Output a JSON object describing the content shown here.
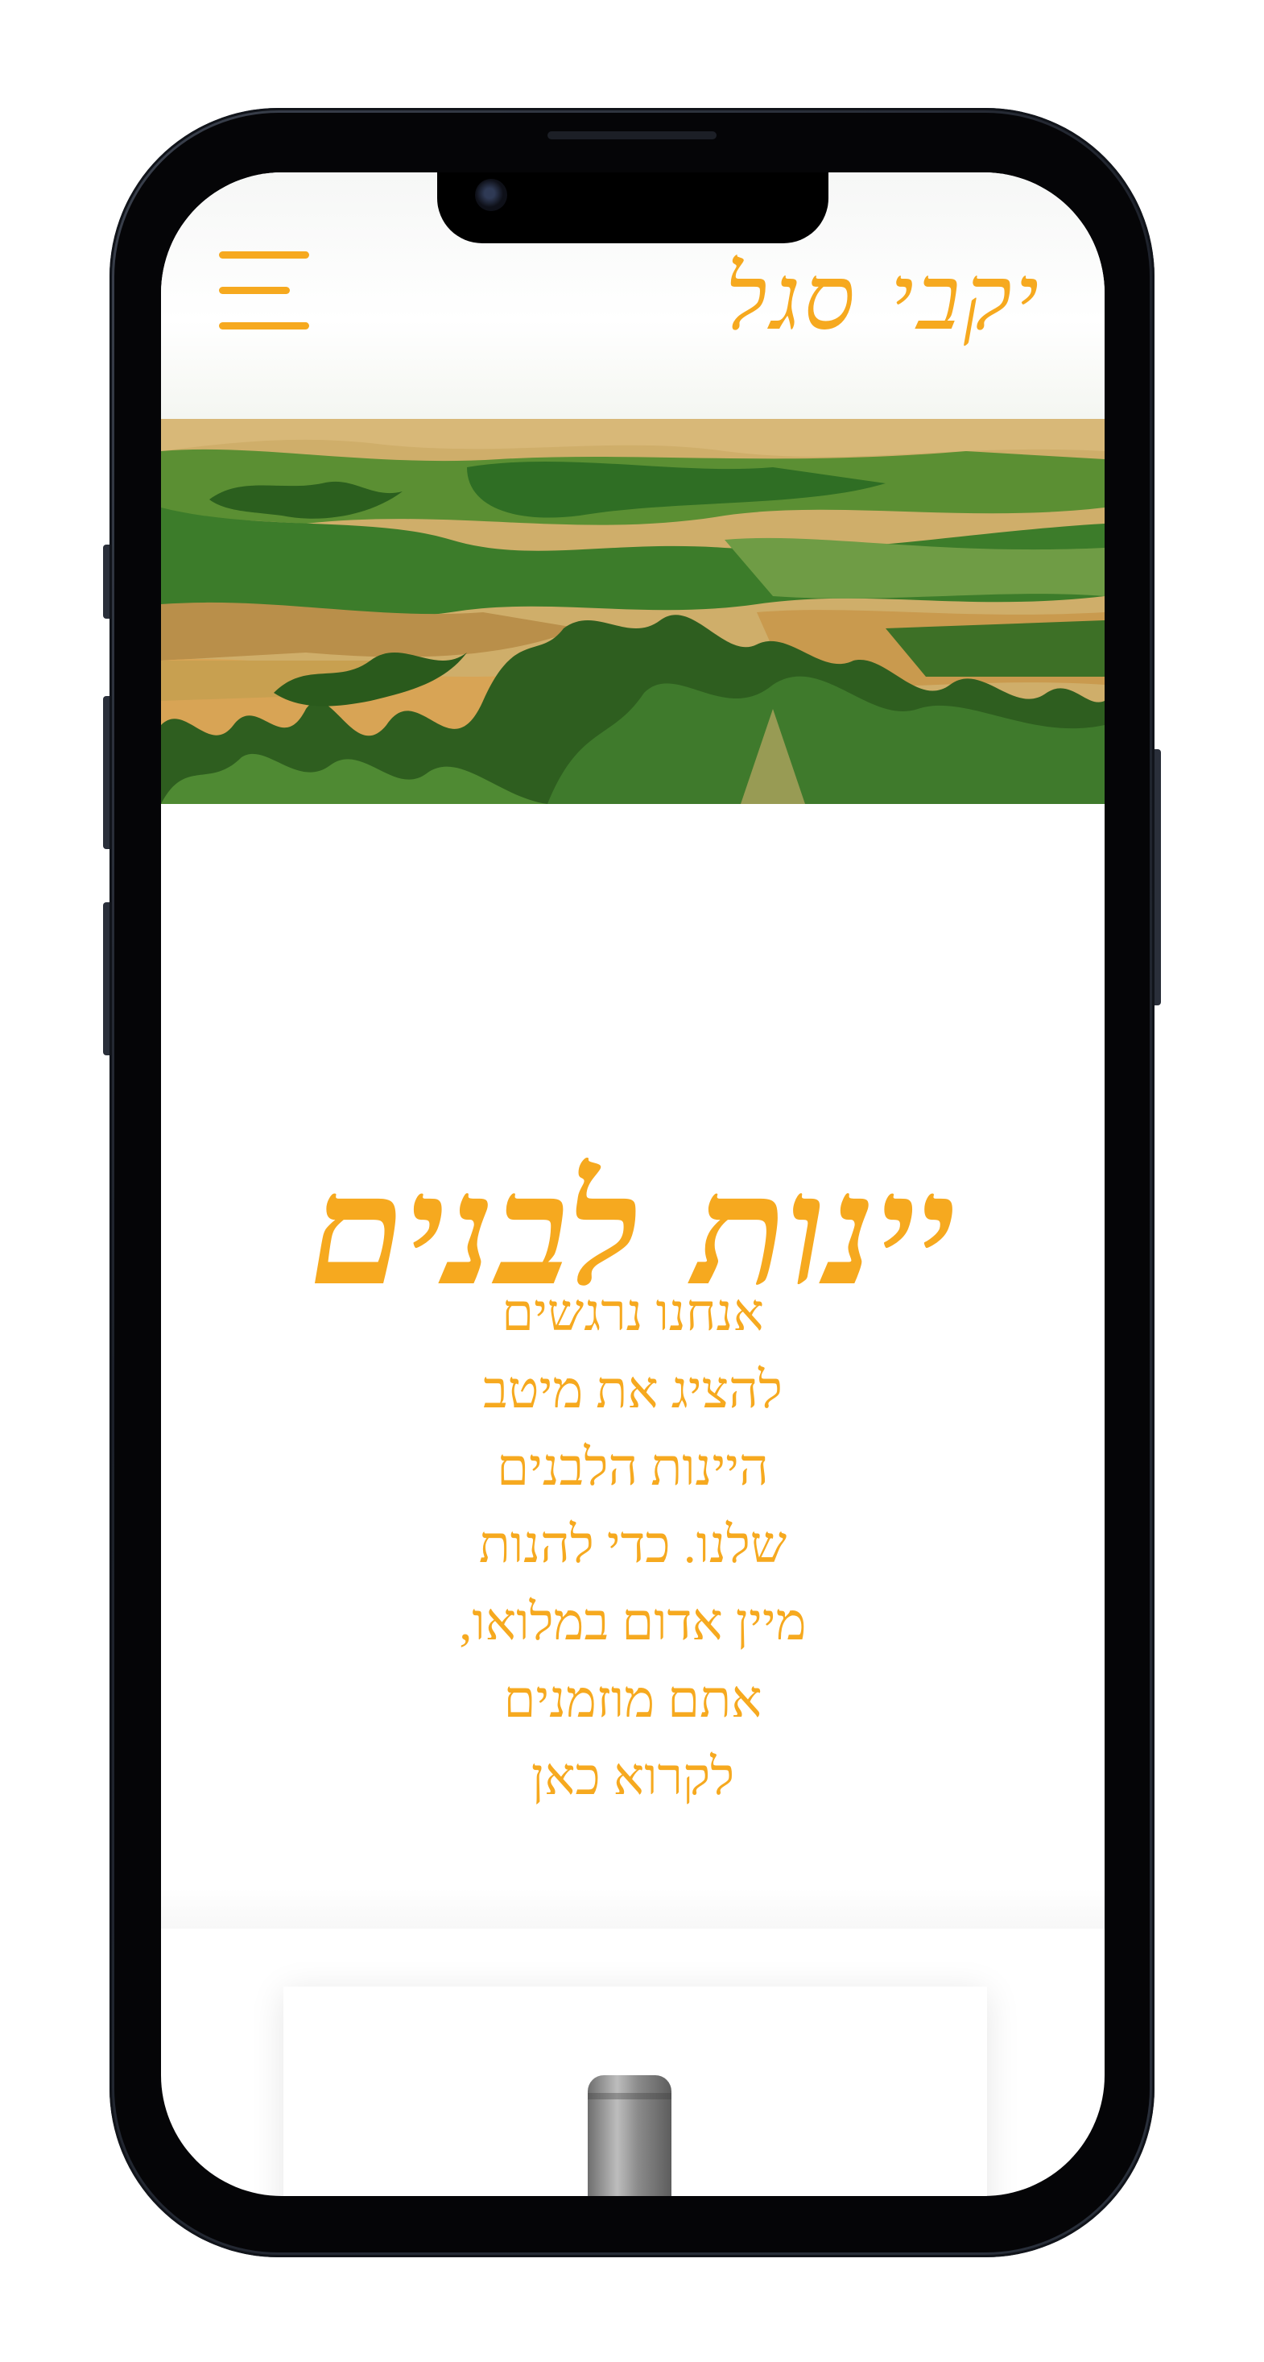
{
  "header": {
    "logo_text": "יקבי סגל",
    "menu_icon": "hamburger-menu-icon"
  },
  "hero": {
    "image_alt": "vineyard-landscape"
  },
  "main": {
    "heading": "יינות לבנים",
    "intro_lines": [
      "אנחנו נרגשים",
      "להציג את מיטב",
      "היינות הלבנים",
      "שלנו. כדי להנות",
      "מיין אדום במלואו,",
      "אתם מוזמנים",
      "לקרוא כאן"
    ]
  },
  "colors": {
    "accent": "#f6a91f"
  }
}
